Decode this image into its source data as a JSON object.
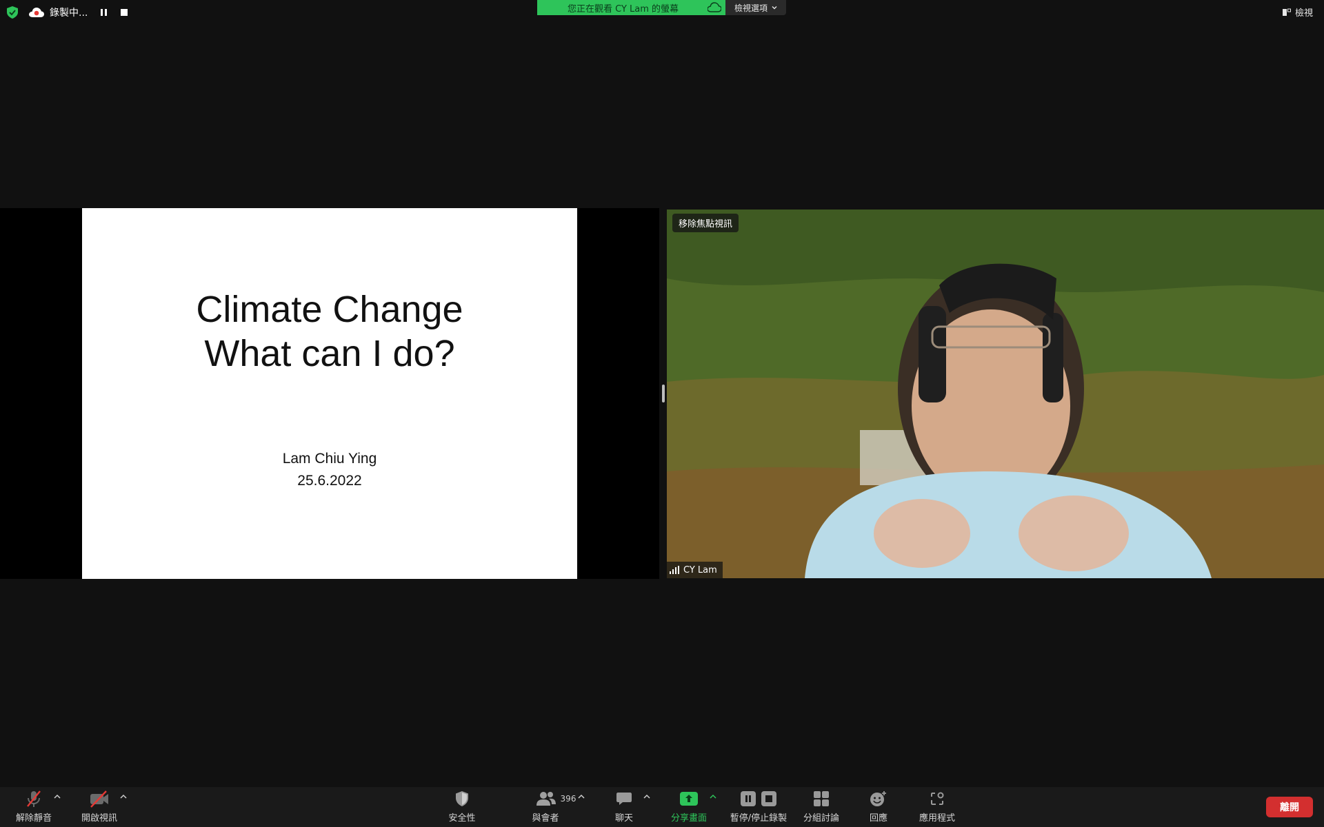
{
  "topbar": {
    "recording_label": "錄製中...",
    "viewing_banner": "您正在觀看 CY Lam 的螢幕",
    "view_options": "檢視選項",
    "view_button": "檢視"
  },
  "slide": {
    "title_line1": "Climate Change",
    "title_line2": "What can I do?",
    "author": "Lam Chiu Ying",
    "date": "25.6.2022"
  },
  "video": {
    "unpin_label": "移除焦點視訊",
    "participant_name": "CY Lam"
  },
  "toolbar": {
    "unmute": "解除靜音",
    "start_video": "開啟視訊",
    "security": "安全性",
    "participants": "與會者",
    "participants_count": "396",
    "chat": "聊天",
    "share_screen": "分享畫面",
    "pause_stop_recording": "暫停/停止錄製",
    "breakout_rooms": "分組討論",
    "reactions": "回應",
    "apps": "應用程式",
    "leave": "離開"
  },
  "colors": {
    "background": "#111111",
    "share_green": "#2ec45a",
    "leave_red": "#d32f2f"
  }
}
